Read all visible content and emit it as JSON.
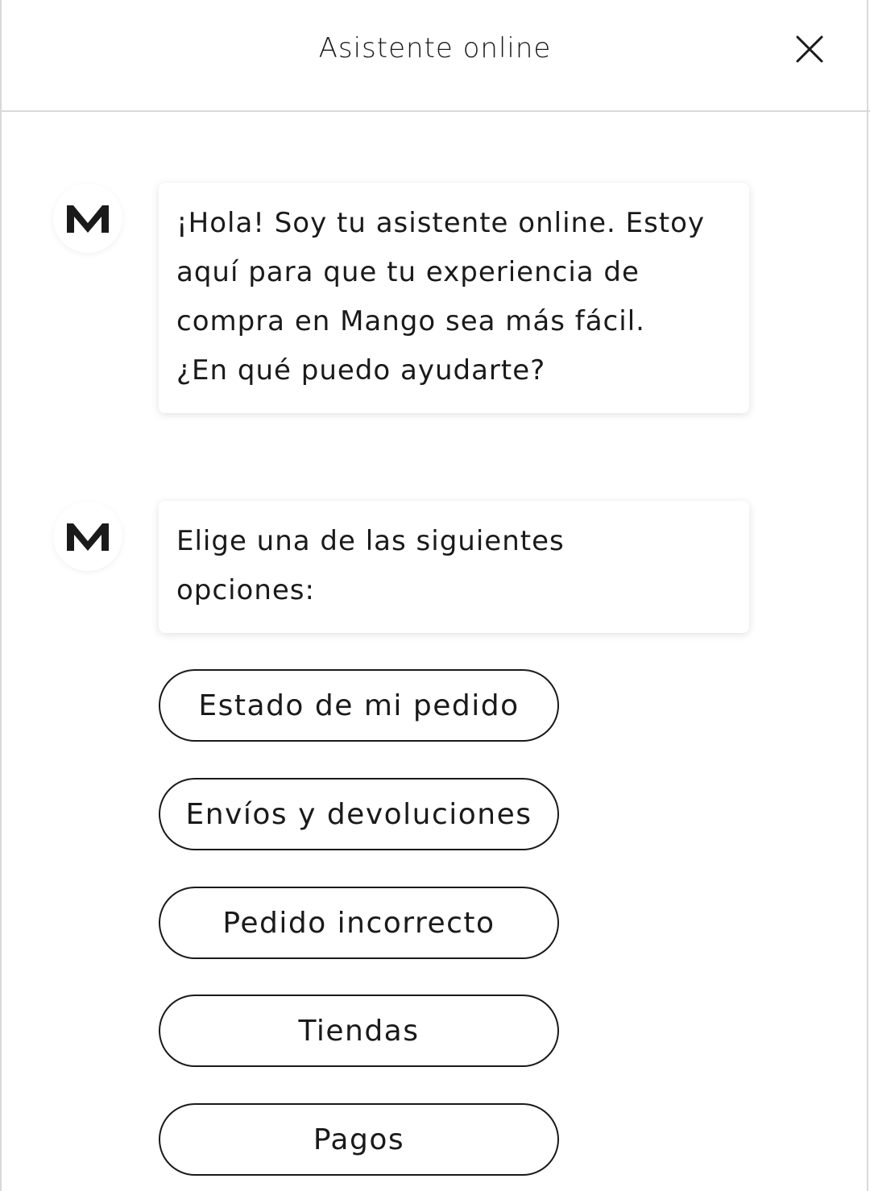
{
  "header": {
    "title": "Asistente online",
    "close_icon": "close-icon"
  },
  "avatar": {
    "letter": "M",
    "icon": "mango-logo"
  },
  "messages": [
    {
      "lines": [
        "¡Hola! Soy tu asistente online. Estoy",
        "aquí para que tu experiencia de",
        "compra en Mango sea más fácil.",
        "¿En qué puedo ayudarte?"
      ]
    },
    {
      "lines": [
        "Elige una de las siguientes",
        "opciones:"
      ]
    }
  ],
  "options": [
    "Estado de mi pedido",
    "Envíos y devoluciones",
    "Pedido incorrecto",
    "Tiendas",
    "Pagos"
  ],
  "colors": {
    "text": "#1a1a1a",
    "divider": "#d9d9d9",
    "background": "#ffffff"
  }
}
